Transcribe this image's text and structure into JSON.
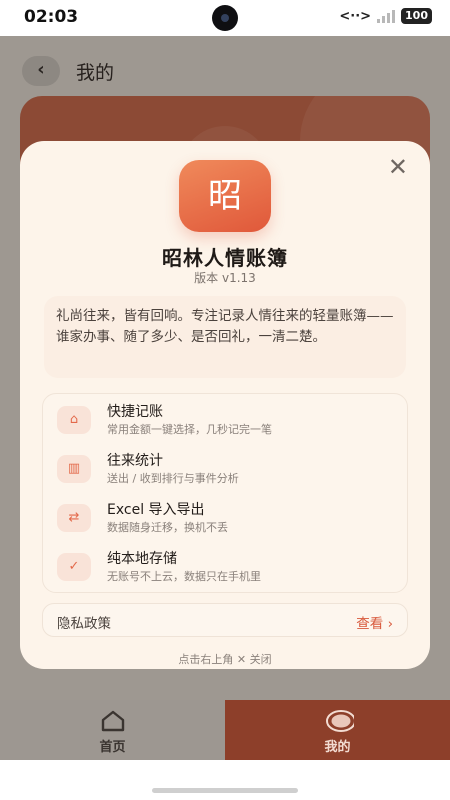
{
  "status_bar": {
    "time": "02:03",
    "network": "<··>",
    "signal_mark": "×",
    "battery": "100"
  },
  "header": {
    "back_icon": "‹",
    "title": "我的"
  },
  "modal": {
    "close_icon": "✕",
    "logo_char": "昭",
    "app_name": "昭林人情账簿",
    "version": "版本 v1.13",
    "intro": "礼尚往来，皆有回响。专注记录人情往来的轻量账簿——谁家办事、随了多少、是否回礼，一清二楚。",
    "features": [
      {
        "icon": "home-icon",
        "glyph": "⌂",
        "title": "快捷记账",
        "desc": "常用金额一键选择，几秒记完一笔"
      },
      {
        "icon": "bar-chart-icon",
        "glyph": "▥",
        "title": "往来统计",
        "desc": "送出 / 收到排行与事件分析"
      },
      {
        "icon": "swap-icon",
        "glyph": "⇄",
        "title": "Excel 导入导出",
        "desc": "数据随身迁移，换机不丢"
      },
      {
        "icon": "check-icon",
        "glyph": "✓",
        "title": "纯本地存储",
        "desc": "无账号不上云，数据只在手机里"
      }
    ],
    "privacy": {
      "label": "隐私政策",
      "link": "查看 ›"
    },
    "close_hint": "点击右上角 ✕ 关闭"
  },
  "bottom_nav": {
    "items": [
      {
        "label": "首页",
        "icon": "home-icon",
        "active": false
      },
      {
        "label": "我的",
        "icon": "profile-icon",
        "active": true
      }
    ]
  },
  "colors": {
    "accent": "#e0583a",
    "active_tab": "#8d3f2a",
    "modal_bg": "#fdf4ea"
  }
}
